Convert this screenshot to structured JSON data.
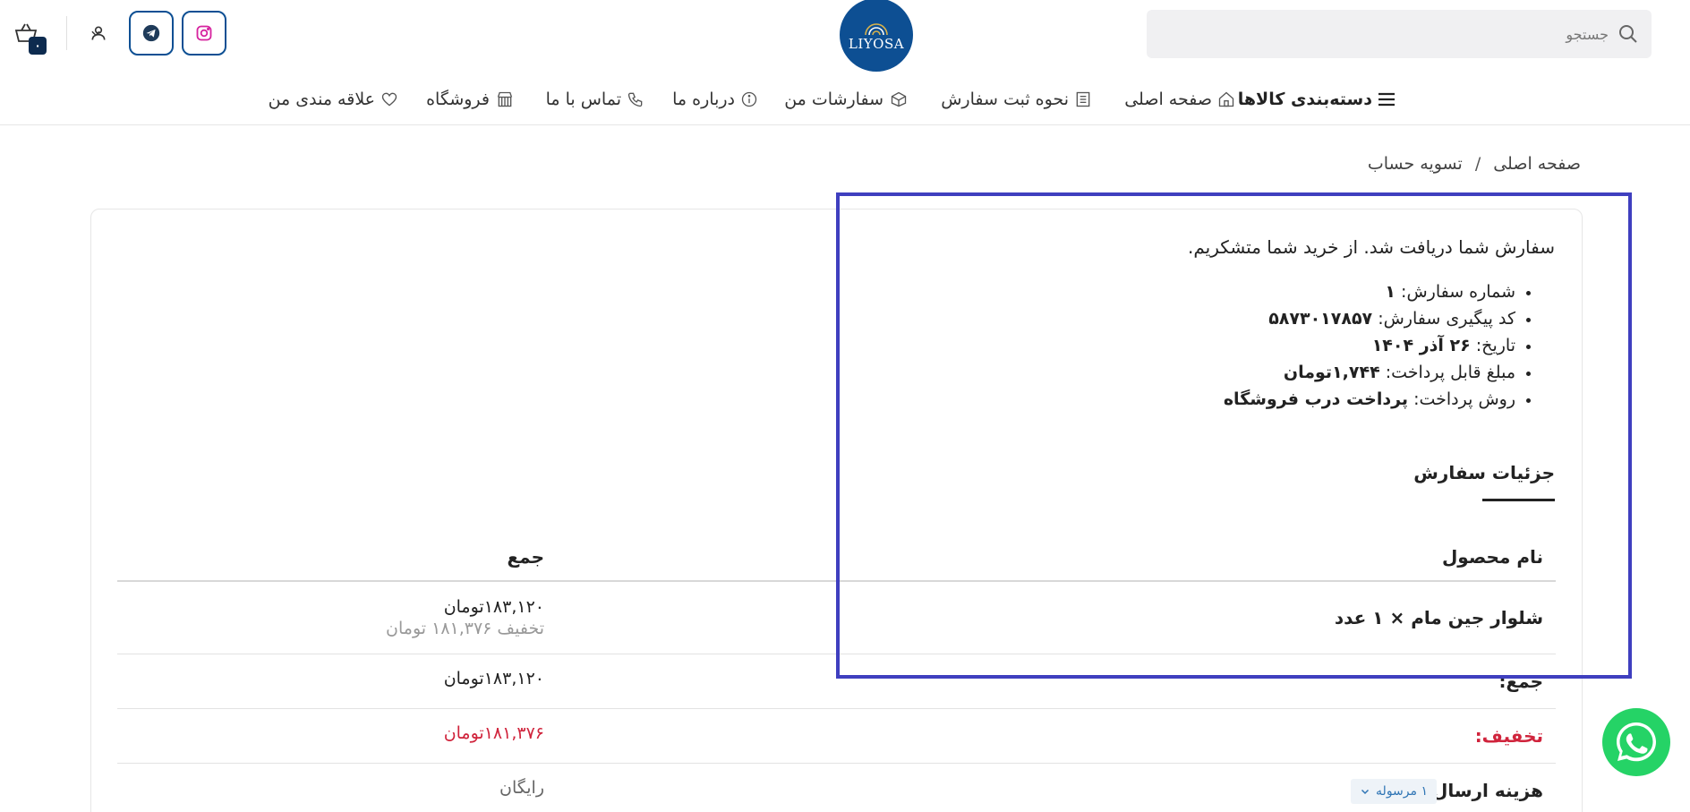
{
  "header": {
    "search": {
      "placeholder": "جستجو",
      "icon": "search-icon"
    },
    "logo": {
      "text": "LIYOSA",
      "bg_color": "#0d4f93"
    },
    "social": [
      {
        "name": "instagram",
        "icon": "instagram-icon",
        "color": "#d6249f"
      },
      {
        "name": "telegram",
        "icon": "telegram-icon",
        "color": "#1f3b5a"
      }
    ],
    "cart": {
      "count": "۰",
      "icon": "basket-icon"
    },
    "user": {
      "icon": "user-icon",
      "chevron": "chevron-down-icon"
    },
    "accent_color": "#0d4f93"
  },
  "nav": {
    "categories": "دسته‌بندی کالاها",
    "home": "صفحه اصلی",
    "how_to_order": "نحوه ثبت سفارش",
    "my_orders": "سفارشات من",
    "about": "درباره ما",
    "contact": "تماس با ما",
    "shop": "فروشگاه",
    "wishlist": "علاقه مندی من"
  },
  "breadcrumb": {
    "home": "صفحه اصلی",
    "separator": "/",
    "current": "تسویه حساب"
  },
  "order": {
    "thanks_message": "سفارش شما دریافت شد. از خرید شما متشکریم.",
    "details": [
      {
        "label": "شماره سفارش:",
        "value": "۱"
      },
      {
        "label": "کد پیگیری سفارش:",
        "value": "۵۸۷۳۰۱۷۸۵۷"
      },
      {
        "label": "تاریخ:",
        "value": "۲۶ آذر ۱۴۰۴"
      },
      {
        "label": "مبلغ قابل پرداخت:",
        "value": "۱,۷۴۴تومان"
      },
      {
        "label": "روش پرداخت:",
        "value": "پرداخت درب فروشگاه"
      }
    ],
    "section_title": "جزئیات سفارش"
  },
  "table": {
    "headers": {
      "product": "نام محصول",
      "total": "جمع"
    },
    "item": {
      "name": "شلوار جین مام × ۱ عدد",
      "price": "۱۸۳,۱۲۰تومان",
      "saving": "تخفیف ۱۸۱,۳۷۶ تومان"
    },
    "subtotal": {
      "label": "جمع:",
      "value": "۱۸۳,۱۲۰تومان"
    },
    "discount": {
      "label": "تخفیف:",
      "value": "۱۸۱,۳۷۶تومان",
      "color": "#d0243c"
    },
    "shipping": {
      "label": "هزینه ارسال:",
      "pill": "۱ مرسوله",
      "value": "رایگان"
    }
  },
  "whatsapp": {
    "icon": "whatsapp-icon",
    "color": "#25d366"
  },
  "highlight_color": "#3f3fbf"
}
